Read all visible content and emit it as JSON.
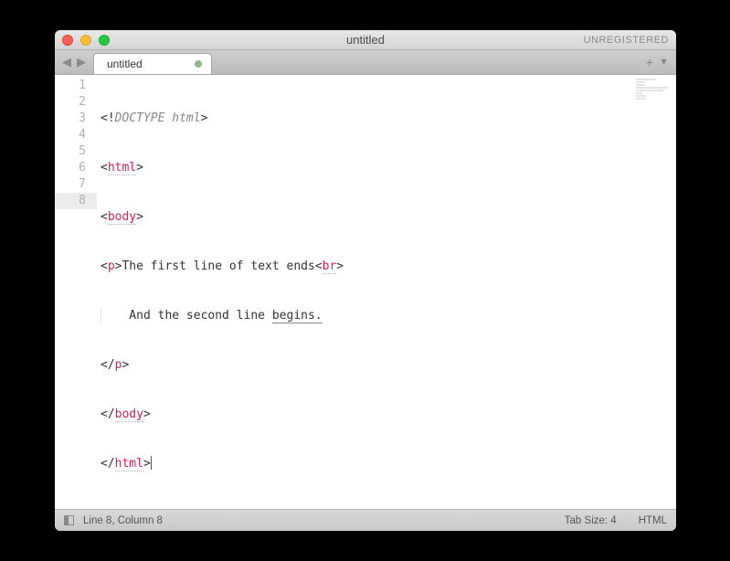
{
  "window": {
    "title": "untitled",
    "registration": "UNREGISTERED"
  },
  "tabs": {
    "items": [
      {
        "label": "untitled",
        "dirty": true
      }
    ]
  },
  "editor": {
    "lines": [
      {
        "num": "1"
      },
      {
        "num": "2"
      },
      {
        "num": "3"
      },
      {
        "num": "4"
      },
      {
        "num": "5"
      },
      {
        "num": "6"
      },
      {
        "num": "7"
      },
      {
        "num": "8"
      }
    ],
    "code": {
      "l1_open": "<!",
      "l1_doctype": "DOCTYPE html",
      "l1_close": ">",
      "l2_open": "<",
      "l2_tag": "html",
      "l2_close": ">",
      "l3_open": "<",
      "l3_tag": "body",
      "l3_close": ">",
      "l4_open": "<",
      "l4_tag": "p",
      "l4_close": ">",
      "l4_text": "The first line of text ends",
      "l4_br_open": "<",
      "l4_br_tag": "br",
      "l4_br_close": ">",
      "l5_text1": "    And the second line ",
      "l5_text2": "begins.",
      "l6_open": "</",
      "l6_tag": "p",
      "l6_close": ">",
      "l7_open": "</",
      "l7_tag": "body",
      "l7_close": ">",
      "l8_open": "</",
      "l8_tag": "html",
      "l8_close": ">"
    },
    "active_line": 8
  },
  "statusbar": {
    "position": "Line 8, Column 8",
    "tabsize": "Tab Size: 4",
    "syntax": "HTML"
  }
}
